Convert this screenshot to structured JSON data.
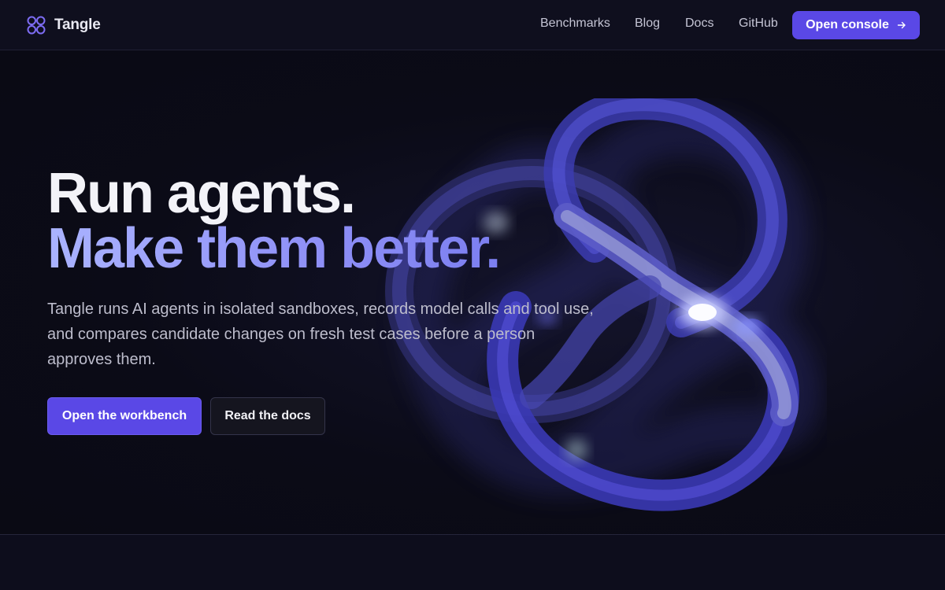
{
  "header": {
    "brand": {
      "name": "Tangle",
      "icon": "tangle-logo-icon"
    },
    "nav": [
      {
        "label": "Benchmarks"
      },
      {
        "label": "Blog"
      },
      {
        "label": "Docs"
      },
      {
        "label": "GitHub"
      }
    ],
    "cta": {
      "label": "Open console",
      "icon": "arrow-right-icon"
    }
  },
  "hero": {
    "headline_line1": "Run agents.",
    "headline_line2": "Make them better.",
    "description": "Tangle runs AI agents in isolated sandboxes, records model calls and tool use, and compares candidate changes on fresh test cases before a person approves them.",
    "primary_button": "Open the workbench",
    "secondary_button": "Read the docs",
    "illustration": "trefoil-knot-illustration"
  },
  "colors": {
    "accent": "#5a48e6",
    "background": "#0b0b16",
    "headline_gradient": "#9aa3ff"
  }
}
